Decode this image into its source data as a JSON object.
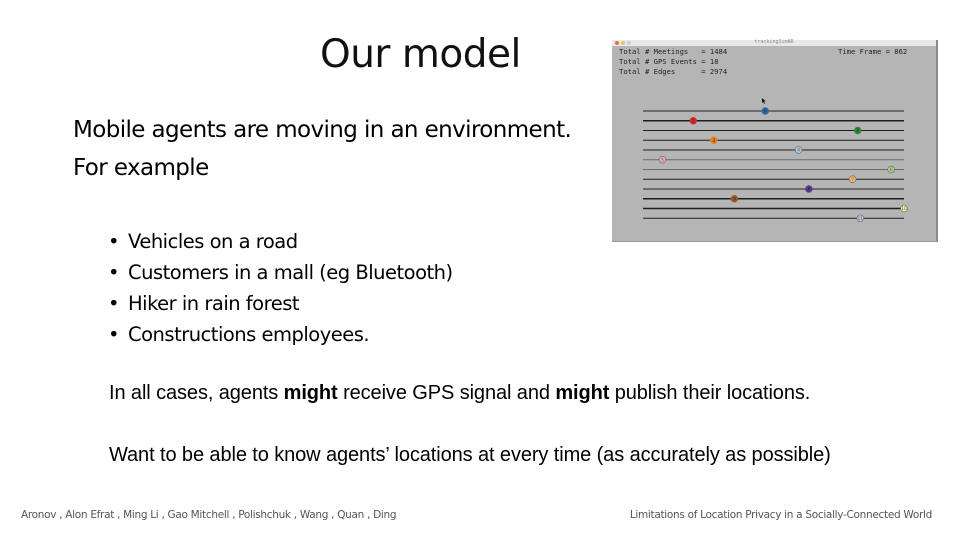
{
  "slide": {
    "title": "Our model",
    "intro": [
      "Mobile agents are moving in an environment.",
      "For example"
    ],
    "bullet_glyph": "•",
    "bullets": [
      "Vehicles on a road",
      "Customers in a mall (eg Bluetooth)",
      "Hiker in rain forest",
      "Constructions employees."
    ],
    "paragraph1": {
      "part1": "In all cases, agents ",
      "bold1": "might",
      "part2": " receive GPS signal and ",
      "bold2": "might",
      "part3": " publish their locations."
    },
    "paragraph2": "Want to be able to know agents’  locations at every time  (as accurately as possible)",
    "footer_left": "Aronov , Alon Efrat , Ming  Li ,   Gao  Mitchell , Polishchuk , Wang , Quan , Ding",
    "footer_right": "Limitations of Location Privacy in a Socially-Connected World"
  },
  "simulation": {
    "window_title": "trackingSimAR",
    "stats": [
      {
        "label": "Total # Meetings",
        "value": "1484"
      },
      {
        "label": "Total # GPS Events",
        "value": "18"
      },
      {
        "label": "Total # Edges",
        "value": "2974"
      }
    ],
    "time_frame_label": "Time Frame",
    "time_frame_value": "862",
    "track_count": 12,
    "agents": [
      {
        "id": "0",
        "track": 0,
        "position": 0.46,
        "color": "#2a6aa8",
        "filled": true
      },
      {
        "id": "1",
        "track": 1,
        "position": 0.18,
        "color": "#d42a2a",
        "filled": true
      },
      {
        "id": "2",
        "track": 2,
        "position": 0.82,
        "color": "#2f8a2f",
        "filled": true
      },
      {
        "id": "3",
        "track": 3,
        "position": 0.26,
        "color": "#e8821e",
        "filled": true
      },
      {
        "id": "4",
        "track": 4,
        "position": 0.59,
        "color": "#a9c8e6",
        "filled": false
      },
      {
        "id": "5",
        "track": 5,
        "position": 0.06,
        "color": "#f2a8a8",
        "filled": false
      },
      {
        "id": "6",
        "track": 6,
        "position": 0.95,
        "color": "#a8d08a",
        "filled": false
      },
      {
        "id": "7",
        "track": 7,
        "position": 0.8,
        "color": "#f5b870",
        "filled": false
      },
      {
        "id": "8",
        "track": 8,
        "position": 0.63,
        "color": "#5a3a92",
        "filled": true
      },
      {
        "id": "9",
        "track": 9,
        "position": 0.34,
        "color": "#9a5a2a",
        "filled": true
      },
      {
        "id": "10",
        "track": 10,
        "position": 1.0,
        "color": "#f2f0a0",
        "filled": false
      },
      {
        "id": "11",
        "track": 11,
        "position": 0.83,
        "color": "#c8bede",
        "filled": false
      }
    ]
  }
}
